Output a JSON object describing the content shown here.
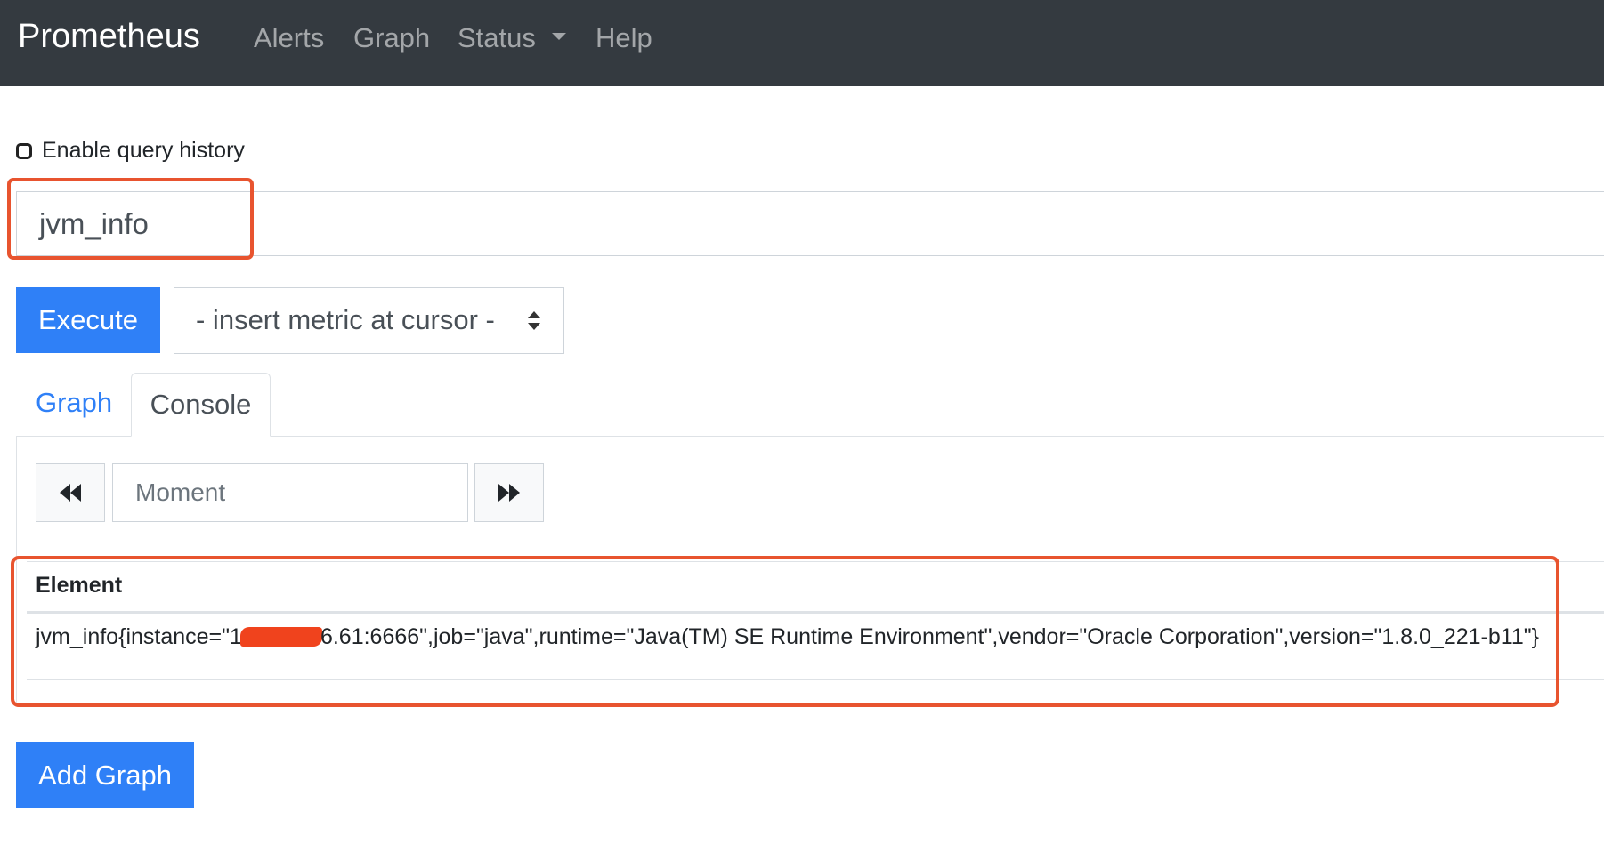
{
  "navbar": {
    "brand": "Prometheus",
    "items": [
      {
        "label": "Alerts"
      },
      {
        "label": "Graph"
      },
      {
        "label": "Status"
      },
      {
        "label": "Help"
      }
    ]
  },
  "query_history": {
    "label": "Enable query history",
    "checked": false
  },
  "expression": {
    "value": "jvm_info"
  },
  "execute_label": "Execute",
  "metric_select": {
    "selected": "- insert metric at cursor -"
  },
  "tabs": {
    "graph": "Graph",
    "console": "Console",
    "active": "Console"
  },
  "time_controls": {
    "moment_placeholder": "Moment"
  },
  "results": {
    "column_header": "Element",
    "rows": [
      {
        "element_prefix": "jvm_info{instance=\"1",
        "element_suffix": "6.61:6666\",job=\"java\",runtime=\"Java(TM) SE Runtime Environment\",vendor=\"Oracle Corporation\",version=\"1.8.0_221-b11\"}"
      }
    ]
  },
  "add_graph_label": "Add Graph",
  "colors": {
    "navbar_bg": "#343a40",
    "primary": "#2f80f7",
    "highlight": "#e8542f",
    "redaction": "#f0431d"
  }
}
